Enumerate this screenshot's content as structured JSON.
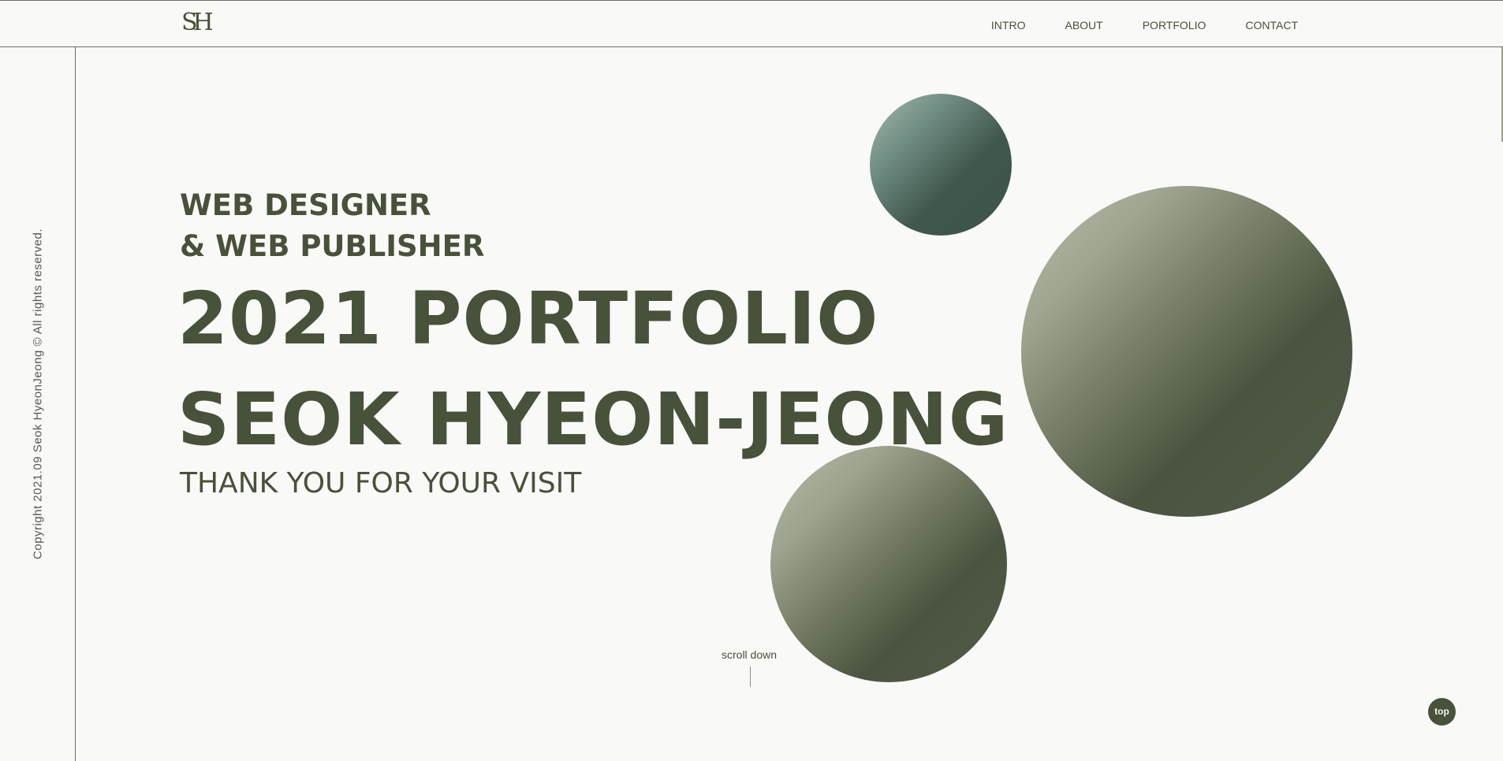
{
  "header": {
    "logo": "SH",
    "nav": [
      {
        "label": "INTRO"
      },
      {
        "label": "ABOUT"
      },
      {
        "label": "PORTFOLIO"
      },
      {
        "label": "CONTACT"
      }
    ]
  },
  "sidebar": {
    "copyright": "Copyright 2021.09 Seok HyeonJeong © All rights reserved."
  },
  "hero": {
    "subtitle_line1": "WEB DESIGNER",
    "subtitle_line2": "& WEB PUBLISHER",
    "title": "2021 PORTFOLIO",
    "name": "SEOK HYEON-JEONG",
    "thanks": "THANK YOU FOR YOUR VISIT"
  },
  "scroll": {
    "label": "scroll down"
  },
  "top_button": {
    "label": "top"
  },
  "colors": {
    "background": "#f9f9f7",
    "primary_text": "#48513a",
    "sphere_teal": "#3d5449",
    "sphere_olive": "#4b5440",
    "rule": "#6a6f63"
  }
}
